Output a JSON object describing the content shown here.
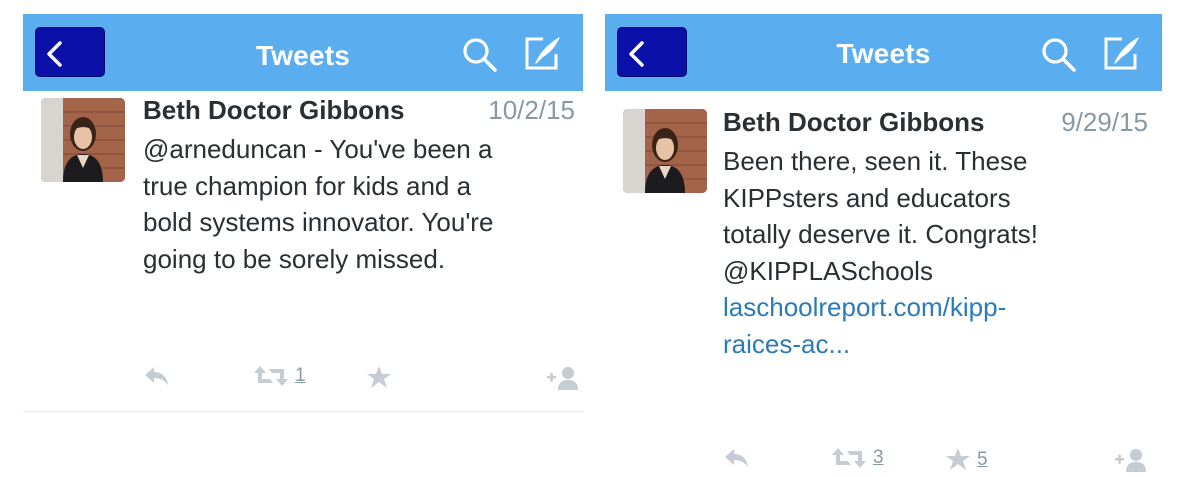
{
  "colors": {
    "navbar": "#5aaef0",
    "back_button": "#0a10a8",
    "text": "#292f33",
    "muted": "#8899a6",
    "link": "#2b7bb9"
  },
  "left": {
    "navbar": {
      "title": "Tweets",
      "icons": [
        "chevron-left-icon",
        "search-icon",
        "compose-icon"
      ]
    },
    "tweet": {
      "author": "Beth Doctor Gibbons",
      "date": "10/2/15",
      "lines": [
        "@arneduncan - You've been a",
        "true champion for kids and a",
        "bold systems innovator. You're",
        "going to be sorely missed."
      ],
      "retweet_count": "1"
    }
  },
  "right": {
    "navbar": {
      "title": "Tweets",
      "icons": [
        "chevron-left-icon",
        "search-icon",
        "compose-icon"
      ]
    },
    "tweet": {
      "author": "Beth Doctor Gibbons",
      "date": "9/29/15",
      "lines": [
        "Been there, seen it. These",
        "KIPPsters and educators",
        "totally deserve it. Congrats!",
        "@KIPPLASchools"
      ],
      "link_lines": [
        "laschoolreport.com/kipp-",
        "raices-ac..."
      ],
      "retweet_count": "3",
      "favorite_count": "5"
    }
  }
}
